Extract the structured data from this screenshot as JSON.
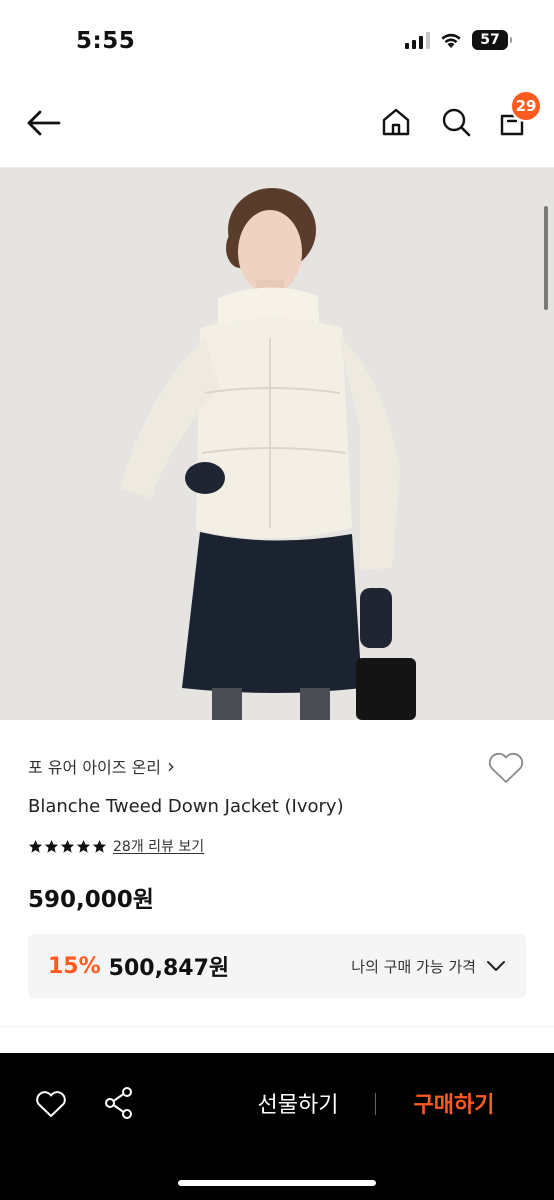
{
  "status_bar": {
    "time": "5:55",
    "battery": "57"
  },
  "header": {
    "cart_count": "29"
  },
  "product": {
    "brand": "포 유어 아이즈 온리",
    "brand_chevron": "›",
    "name": "Blanche Tweed Down Jacket (Ivory)",
    "rating_stars": 5,
    "review_link": "28개 리뷰 보기",
    "price": "590,000원",
    "discount_rate": "15%",
    "discount_price": "500,847원",
    "my_price_label": "나의 구매 가능 가격"
  },
  "bottom_bar": {
    "gift_label": "선물하기",
    "buy_label": "구매하기"
  },
  "colors": {
    "accent": "#ff5a1f",
    "bottom_bar": "#000000",
    "discount_bg": "#f5f5f5"
  },
  "icons": [
    "back-arrow-icon",
    "home-icon",
    "search-icon",
    "shopping-bag-icon",
    "heart-icon",
    "star-icon",
    "chevron-down-icon",
    "share-icon"
  ]
}
